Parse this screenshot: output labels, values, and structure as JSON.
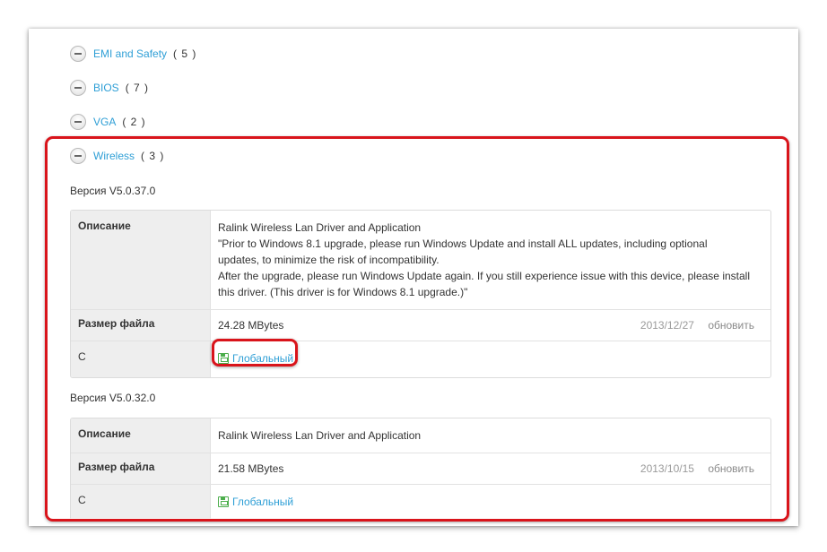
{
  "categories": [
    {
      "name": "EMI and Safety",
      "count": "( 5 )"
    },
    {
      "name": "BIOS",
      "count": "( 7 )"
    },
    {
      "name": "VGA",
      "count": "( 2 )"
    },
    {
      "name": "Wireless",
      "count": "( 3 )"
    }
  ],
  "versions": [
    {
      "title": "Версия V5.0.37.0",
      "description_label": "Описание",
      "description_lines": [
        "Ralink Wireless Lan Driver and Application",
        "\"Prior to Windows 8.1 upgrade, please run Windows Update and install ALL updates, including optional",
        "updates, to minimize the risk of incompatibility.",
        "After the upgrade, please run Windows Update again. If you still experience issue with this device, please install",
        "this driver. (This driver is for Windows 8.1 upgrade.)\""
      ],
      "size_label": "Размер файла",
      "size": "24.28 MBytes",
      "date": "2013/12/27",
      "update": "обновить",
      "source_label": "С",
      "download": "Глобальный"
    },
    {
      "title": "Версия V5.0.32.0",
      "description_label": "Описание",
      "description_lines": [
        "Ralink Wireless Lan Driver and Application"
      ],
      "size_label": "Размер файла",
      "size": "21.58 MBytes",
      "date": "2013/10/15",
      "update": "обновить",
      "source_label": "С",
      "download": "Глобальный"
    }
  ],
  "colors": {
    "link": "#2f9fd6",
    "highlight": "#d9141b",
    "download_icon": "#4cae4c"
  }
}
